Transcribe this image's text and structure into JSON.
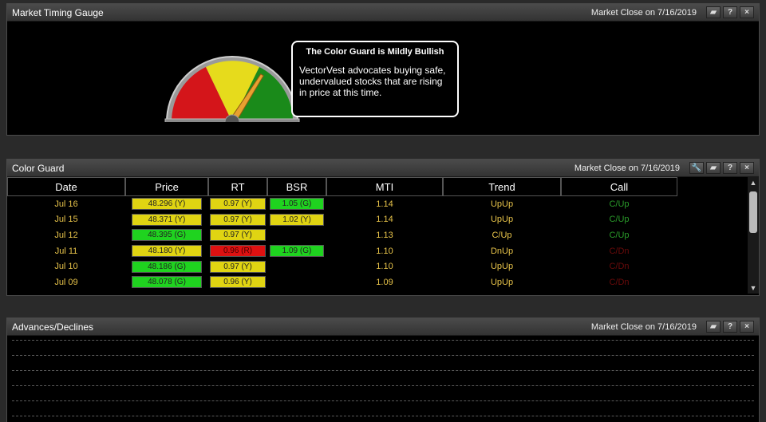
{
  "gauge_panel": {
    "title": "Market Timing Gauge",
    "date": "Market Close on 7/16/2019",
    "callout_title": "The Color Guard is Mildly Bullish",
    "callout_lines": [
      "VectorVest advocates buying safe,",
      "undervalued stocks that are rising",
      "in price at this time."
    ],
    "gauge_level_fraction": 0.68,
    "gauge_colors": [
      "#d4151a",
      "#e6db1c",
      "#1a8a1a"
    ]
  },
  "color_guard_panel": {
    "title": "Color Guard",
    "date": "Market Close on 7/16/2019",
    "columns": [
      "Date",
      "Price",
      "RT",
      "BSR",
      "MTI",
      "Trend",
      "Call"
    ],
    "rows": [
      {
        "date": "Jul 16",
        "price": "48.296 (Y)",
        "price_c": "y",
        "rt": "0.97 (Y)",
        "rt_c": "y",
        "bsr": "1.05 (G)",
        "bsr_c": "g",
        "mti": "1.14",
        "trend": "UpUp",
        "call": "C/Up"
      },
      {
        "date": "Jul 15",
        "price": "48.371 (Y)",
        "price_c": "y",
        "rt": "0.97 (Y)",
        "rt_c": "y",
        "bsr": "1.02 (Y)",
        "bsr_c": "y",
        "mti": "1.14",
        "trend": "UpUp",
        "call": "C/Up"
      },
      {
        "date": "Jul 12",
        "price": "48.395 (G)",
        "price_c": "g",
        "rt": "0.97 (Y)",
        "rt_c": "y",
        "bsr": "",
        "bsr_c": "",
        "mti": "1.13",
        "trend": "C/Up",
        "call": "C/Up"
      },
      {
        "date": "Jul 11",
        "price": "48.180 (Y)",
        "price_c": "y",
        "rt": "0.96 (R)",
        "rt_c": "r",
        "bsr": "1.09 (G)",
        "bsr_c": "g",
        "mti": "1.10",
        "trend": "DnUp",
        "call": "C/Dn"
      },
      {
        "date": "Jul 10",
        "price": "48.186 (G)",
        "price_c": "g",
        "rt": "0.97 (Y)",
        "rt_c": "y",
        "bsr": "",
        "bsr_c": "",
        "mti": "1.10",
        "trend": "UpUp",
        "call": "C/Dn"
      },
      {
        "date": "Jul 09",
        "price": "48.078 (G)",
        "price_c": "g",
        "rt": "0.96 (Y)",
        "rt_c": "y",
        "bsr": "",
        "bsr_c": "",
        "mti": "1.09",
        "trend": "UpUp",
        "call": "C/Dn"
      }
    ]
  },
  "advances_panel": {
    "title": "Advances/Declines",
    "date": "Market Close on 7/16/2019"
  },
  "header_buttons": {
    "chart": "▰",
    "help": "?",
    "close": "×",
    "settings": "🔧"
  },
  "scroll": {
    "up": "▲",
    "down": "▼"
  }
}
